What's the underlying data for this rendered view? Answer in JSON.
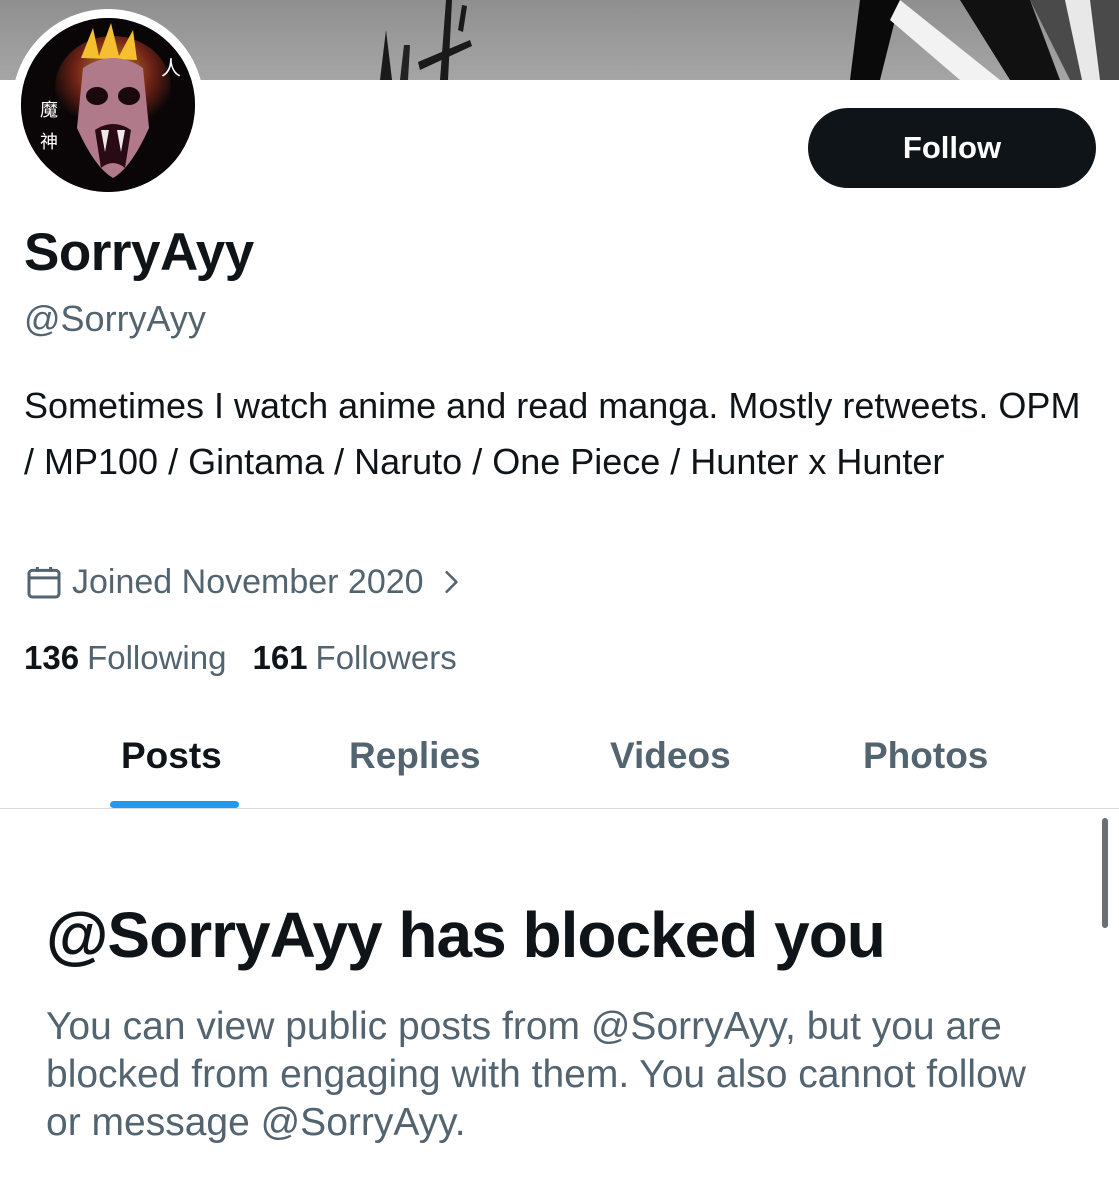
{
  "profile": {
    "display_name": "SorryAyy",
    "handle": "@SorryAyy",
    "bio": "Sometimes I watch anime and read manga. Mostly retweets. OPM / MP100 / Gintama / Naruto / One Piece / Hunter x Hunter",
    "joined": "Joined November 2020",
    "following_count": "136",
    "following_label": "Following",
    "followers_count": "161",
    "followers_label": "Followers",
    "avatar_text": [
      "魔",
      "神",
      "人"
    ]
  },
  "actions": {
    "follow_label": "Follow"
  },
  "tabs": [
    {
      "label": "Posts",
      "active": true
    },
    {
      "label": "Replies",
      "active": false
    },
    {
      "label": "Videos",
      "active": false
    },
    {
      "label": "Photos",
      "active": false
    }
  ],
  "blocked": {
    "title": "@SorryAyy has blocked you",
    "message": "You can view public posts from @SorryAyy, but you are blocked from engaging with them. You also cannot follow or message @SorryAyy."
  },
  "icons": {
    "joined": "calendar-icon",
    "joined_more": "chevron-right-icon"
  },
  "colors": {
    "accent": "#1d9bf0",
    "text": "#0f1419",
    "secondary": "#536471",
    "button": "#0f1419"
  }
}
